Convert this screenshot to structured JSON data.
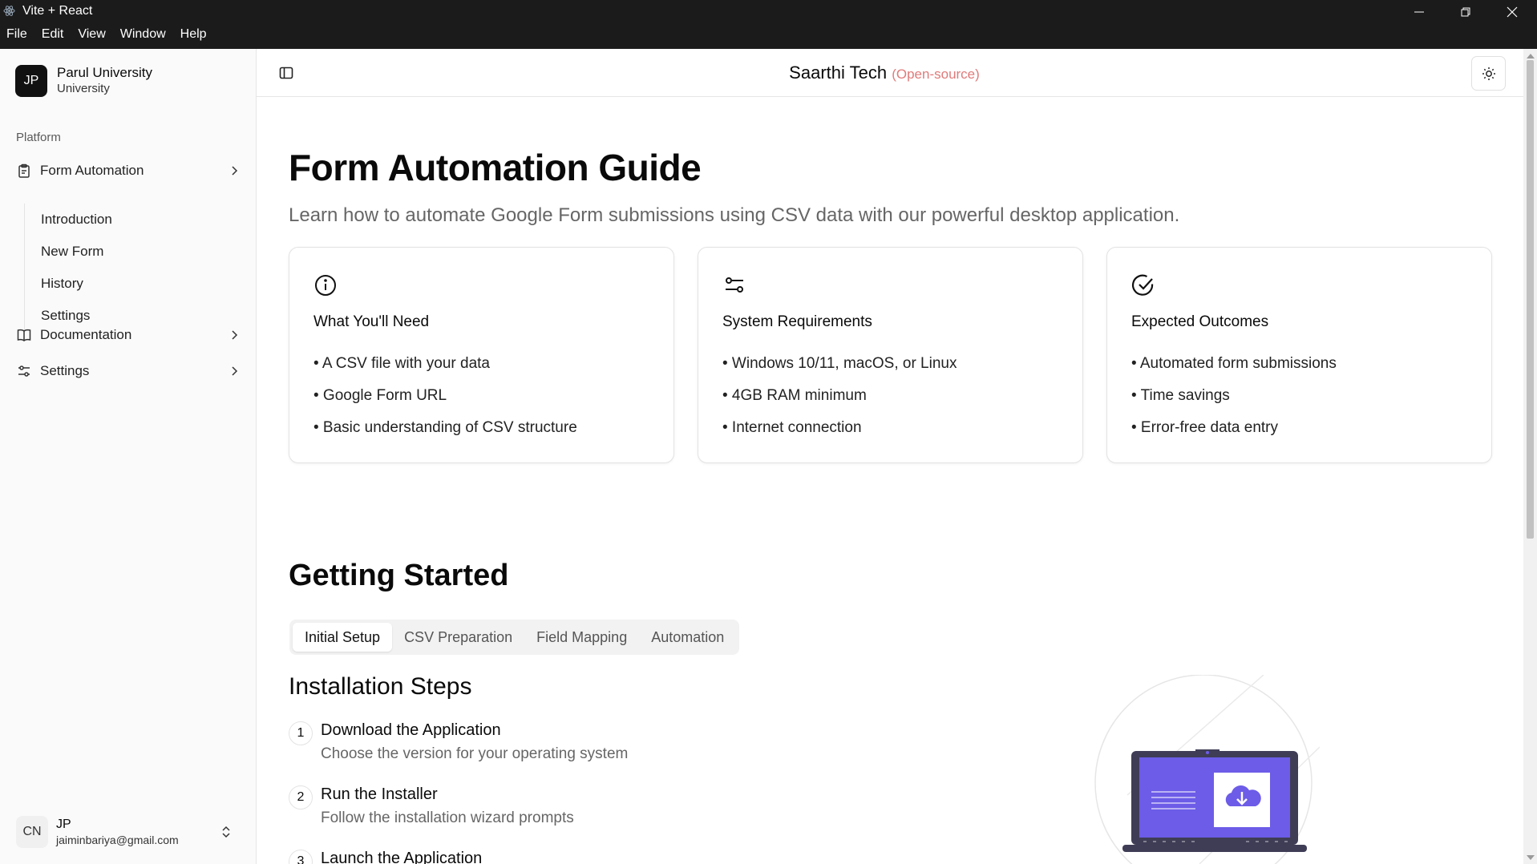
{
  "window": {
    "title": "Vite + React",
    "menu": [
      "File",
      "Edit",
      "View",
      "Window",
      "Help"
    ]
  },
  "sidebar": {
    "brand": {
      "initials": "JP",
      "name": "Parul University",
      "subtitle": "University"
    },
    "section_label": "Platform",
    "items": [
      {
        "label": "Form Automation",
        "icon": "clipboard-icon"
      },
      {
        "label": "Documentation",
        "icon": "book-icon"
      },
      {
        "label": "Settings",
        "icon": "sliders-icon"
      }
    ],
    "subitems": [
      "Introduction",
      "New Form",
      "History",
      "Settings"
    ],
    "user": {
      "initials": "CN",
      "name": "JP",
      "email": "jaiminbariya@gmail.com"
    }
  },
  "header": {
    "title": "Saarthi Tech",
    "tag": "(Open-source)"
  },
  "main": {
    "title": "Form Automation Guide",
    "subtitle": "Learn how to automate Google Form submissions using CSV data with our powerful desktop application.",
    "cards": [
      {
        "icon": "info-icon",
        "title": "What You'll Need",
        "items": [
          "• A CSV file with your data",
          "• Google Form URL",
          "• Basic understanding of CSV structure"
        ]
      },
      {
        "icon": "sliders-icon",
        "title": "System Requirements",
        "items": [
          "• Windows 10/11, macOS, or Linux",
          "• 4GB RAM minimum",
          "• Internet connection"
        ]
      },
      {
        "icon": "check-circle-icon",
        "title": "Expected Outcomes",
        "items": [
          "• Automated form submissions",
          "• Time savings",
          "• Error-free data entry"
        ]
      }
    ],
    "getting_started": "Getting Started",
    "tabs": [
      "Initial Setup",
      "CSV Preparation",
      "Field Mapping",
      "Automation"
    ],
    "active_tab": "Initial Setup",
    "steps_title": "Installation Steps",
    "steps": [
      {
        "num": "1",
        "title": "Download the Application",
        "desc": "Choose the version for your operating system"
      },
      {
        "num": "2",
        "title": "Run the Installer",
        "desc": "Follow the installation wizard prompts"
      },
      {
        "num": "3",
        "title": "Launch the Application",
        "desc": ""
      }
    ]
  },
  "colors": {
    "accent_illustration": "#6c5ce7",
    "tag": "#e07a7a"
  }
}
